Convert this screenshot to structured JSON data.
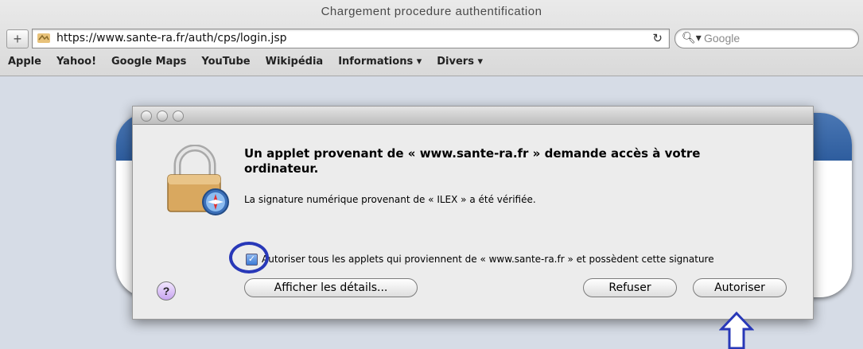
{
  "window": {
    "title": "Chargement procedure authentification"
  },
  "toolbar": {
    "add_label": "+",
    "url": "https://www.sante-ra.fr/auth/cps/login.jsp",
    "reload_glyph": "↻",
    "search_placeholder": "Google"
  },
  "bookmarks": [
    "Apple",
    "Yahoo!",
    "Google Maps",
    "YouTube",
    "Wikipédia",
    "Informations ▾",
    "Divers ▾"
  ],
  "dialog": {
    "title": "Un applet provenant de « www.sante-ra.fr » demande accès à votre ordinateur.",
    "subtitle": "La signature numérique provenant de « ILEX » a été vérifiée.",
    "checkbox_checked": true,
    "checkbox_label": "Autoriser tous les applets qui proviennent de « www.sante-ra.fr » et possèdent cette signature",
    "help_label": "?",
    "details_button": "Afficher les détails...",
    "refuse_button": "Refuser",
    "allow_button": "Autoriser"
  },
  "colors": {
    "annotation": "#2838b8",
    "page_band": "#3a68a8"
  }
}
